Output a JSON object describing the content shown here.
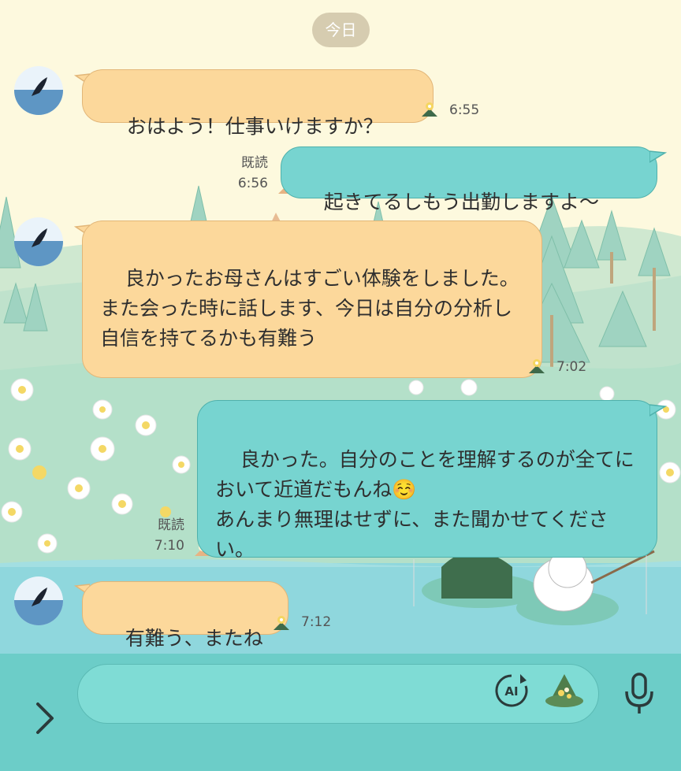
{
  "chat": {
    "date_label": "今日",
    "messages": [
      {
        "dir": "in",
        "text": "おはよう！仕事いけますか？",
        "time": "6:55"
      },
      {
        "dir": "out",
        "text": "起きてるしもう出勤しますよ〜",
        "time": "6:56",
        "read": "既読"
      },
      {
        "dir": "in",
        "text": "良かったお母さんはすごい体験をしました。また会った時に話します、今日は自分の分析し自信を持てるかも有難う",
        "time": "7:02"
      },
      {
        "dir": "out",
        "text": "良かった。自分のことを理解するのが全てにおいて近道だもんね☺️\nあんまり無理はせずに、また聞かせてください。",
        "time": "7:10",
        "read": "既読"
      },
      {
        "dir": "in",
        "text": "有難う、またね",
        "time": "7:12"
      }
    ]
  },
  "input": {
    "placeholder": "",
    "ai_label": "AI"
  },
  "icons": {
    "expand": "chevron-right-icon",
    "ai": "ai-icon",
    "sticker": "snufkin-hat-icon",
    "mic": "microphone-icon",
    "reaction": "flower-reaction-icon"
  },
  "colors": {
    "incoming_bubble": "#fcd89b",
    "outgoing_bubble": "#77d4d0",
    "background": "#fdf9de",
    "input_bar": "#6ccdc8"
  }
}
